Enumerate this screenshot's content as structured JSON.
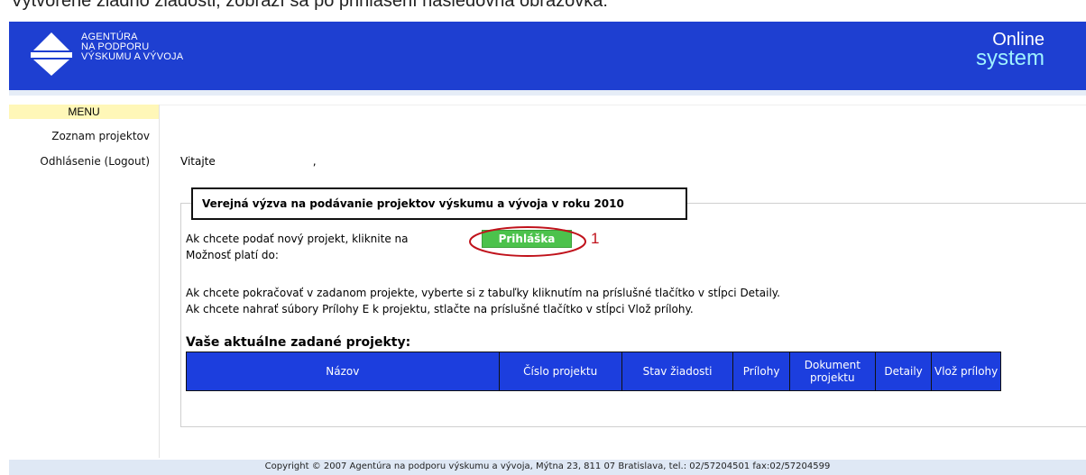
{
  "caption": {
    "text": "Vytvorené žiadno žiadosti, zobrazí sa po prihlásení nasledovná obrazovka:"
  },
  "header": {
    "logo_lines": [
      "AGENTÚRA",
      "NA PODPORU",
      "VÝSKUMU A VÝVOJA"
    ],
    "brand_line1": "Online",
    "brand_line2": "system",
    "colors": {
      "header_bg": "#1e3fd1",
      "brand_accent": "#9ff2ff",
      "logo_mark": "#ffffff"
    }
  },
  "sidebar": {
    "menu_title": "MENU",
    "items": [
      {
        "label": "Zoznam projektov"
      },
      {
        "label": "Odhlásenie (Logout)"
      }
    ]
  },
  "main": {
    "welcome_text": "Vitajte",
    "welcome_suffix": ",",
    "call_title": "Verejná výzva na podávanie projektov výskumu a vývoja v roku 2010",
    "apply_text_prefix": "Ak chcete podať nový projekt, kliknite na",
    "apply_button_label": "Prihláška",
    "callout_number": "1",
    "valid_until_label": "Možnosť platí do:",
    "continue_text": "Ak chcete pokračovať v zadanom projekte, vyberte si z tabuľky kliknutím na príslušné tlačítko v stĺpci Detaily.",
    "upload_text": "Ak chcete nahrať súbory Prílohy E k projektu, stlačte na príslušné tlačítko v stĺpci Vlož prílohy.",
    "projects_heading": "Vaše aktuálne zadané projekty:",
    "table": {
      "columns": [
        "Názov",
        "Číslo projektu",
        "Stav žiadosti",
        "Prílohy",
        "Dokument projektu",
        "Detaily",
        "Vlož prílohy"
      ],
      "rows": []
    }
  },
  "footer": {
    "copyright": "Copyright © 2007 Agentúra na podporu výskumu a vývoja, Mýtna 23, 811 07 Bratislava, tel.: 02/57204501 fax:02/57204599"
  }
}
